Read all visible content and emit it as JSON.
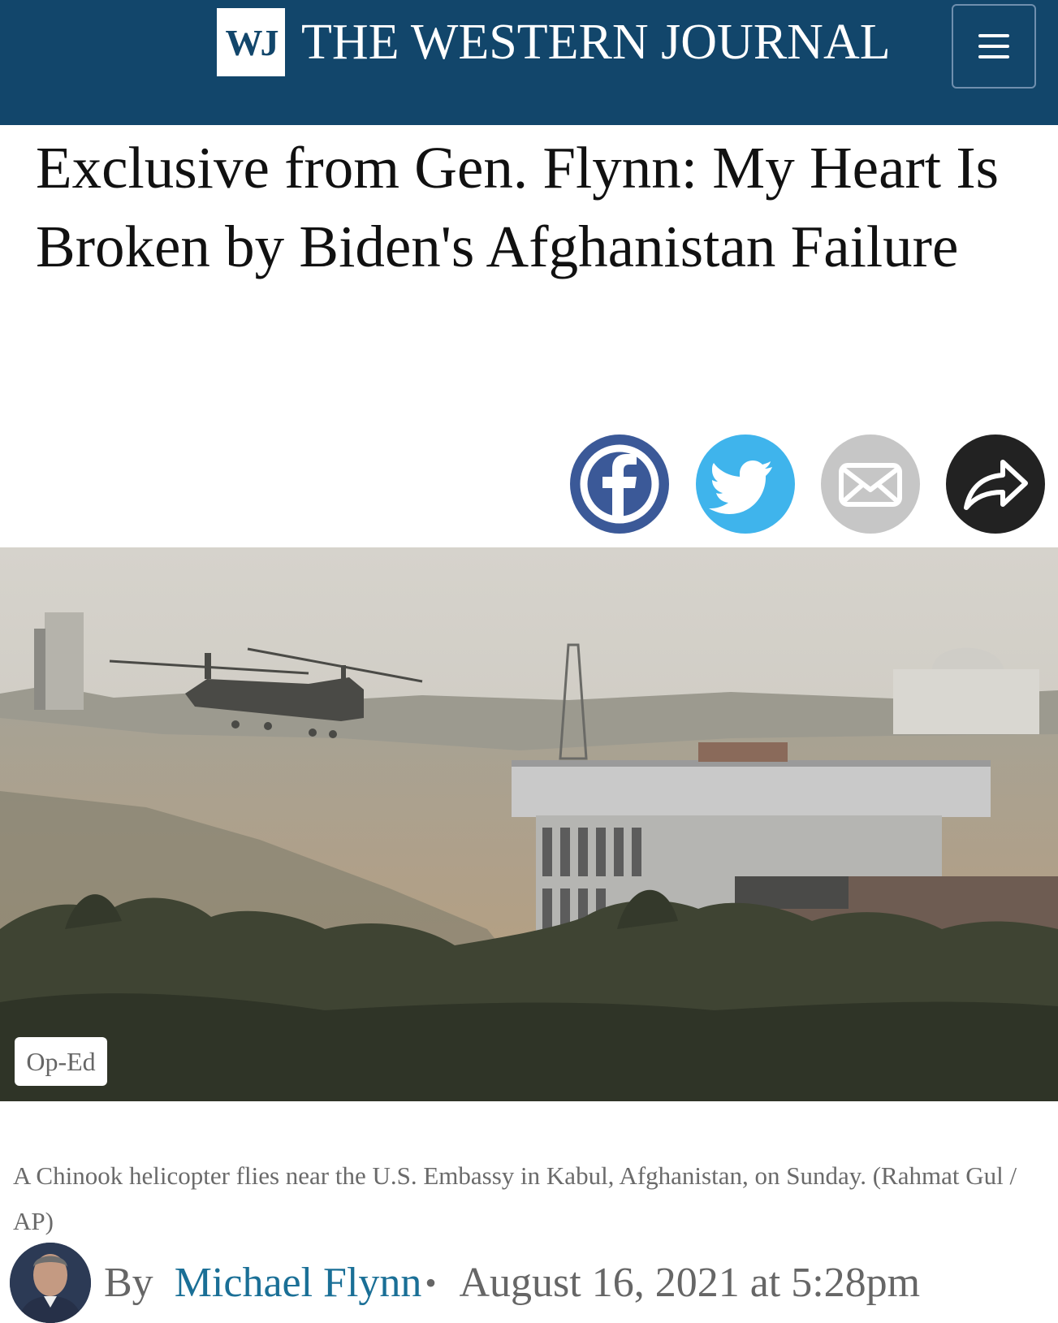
{
  "header": {
    "logo_mark": "WJ",
    "site_name": "THE WESTERN JOURNAL",
    "menu_icon": "hamburger-menu-icon",
    "bg_color": "#12466b"
  },
  "article": {
    "headline": "Exclusive from Gen. Flynn: My Heart Is Broken by Biden's Afghanistan Failure",
    "category_badge": "Op-Ed",
    "photo_icon": "helicopter-embassy-photo",
    "caption": "A Chinook helicopter flies near the U.S. Embassy in Kabul, Afghanistan, on Sunday. (Rahmat Gul / AP)",
    "byline_prefix": "By",
    "author": "Michael Flynn",
    "separator": "•",
    "date": "August 16, 2021 at 5:28pm"
  },
  "share": {
    "facebook": {
      "icon": "facebook-icon",
      "color": "#3b5998"
    },
    "twitter": {
      "icon": "twitter-icon",
      "color": "#3fb4ec"
    },
    "email": {
      "icon": "email-icon",
      "color": "#c6c6c6"
    },
    "share": {
      "icon": "share-arrow-icon",
      "color": "#222222"
    }
  },
  "colors": {
    "author_link": "#1a6f96",
    "caption_text": "#6a6a6a"
  }
}
